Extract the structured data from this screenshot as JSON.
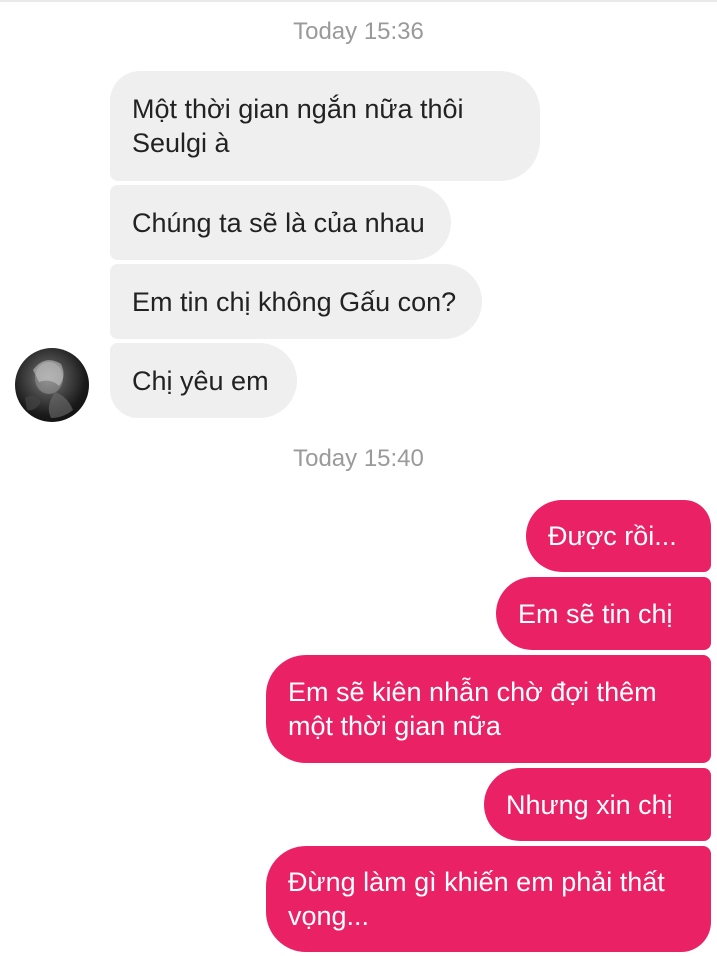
{
  "timestamps": [
    "Today 15:36",
    "Today 15:40"
  ],
  "incoming": [
    {
      "lines": [
        "Một thời gian ngắn nữa thôi",
        "Seulgi à"
      ]
    },
    {
      "lines": [
        "Chúng ta sẽ là của nhau"
      ]
    },
    {
      "lines": [
        "Em tin chị không Gấu con?"
      ]
    },
    {
      "lines": [
        "Chị yêu em"
      ]
    }
  ],
  "outgoing": [
    {
      "lines": [
        "Được rồi..."
      ]
    },
    {
      "lines": [
        "Em sẽ tin chị"
      ]
    },
    {
      "lines": [
        "Em sẽ kiên nhẫn chờ đợi thêm",
        "một thời gian nữa"
      ]
    },
    {
      "lines": [
        "Nhưng xin chị"
      ]
    },
    {
      "lines": [
        "Đừng làm gì khiến em phải thất",
        "vọng..."
      ]
    }
  ],
  "colors": {
    "incoming_bubble": "#efefef",
    "outgoing_bubble": "#ea2164",
    "timestamp_text": "#9a9a9a"
  },
  "icons": {
    "avatar": "contact-avatar"
  }
}
